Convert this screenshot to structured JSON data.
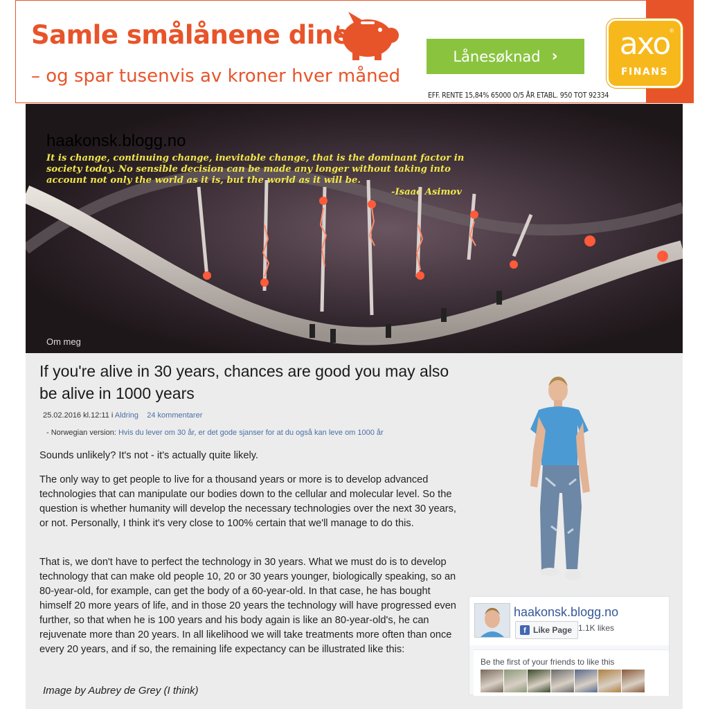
{
  "ad": {
    "headline": "Samle smålånene dine",
    "subline": "– og spar tusenvis av kroner hver måned",
    "cta_label": "Lånesøknad",
    "cta_arrow": "›",
    "fine_print": "EFF. RENTE 15,84% 65000 O/5 ÅR ETABL. 950 TOT 92334",
    "brand": "axo",
    "brand_sub": "FINANS",
    "brand_reg": "®",
    "colors": {
      "orange": "#e8542a",
      "green": "#8ac43f",
      "yellow": "#f7b81b"
    }
  },
  "header": {
    "blog_title": "haakonsk.blogg.no",
    "quote": "It is change, continuing change, inevitable change, that is the dominant factor in society today. No sensible decision can be made any longer without taking into account not only the world as it is, but the world as it will be.",
    "quote_author": "-Isaac Asimov",
    "nav_link": "Om meg"
  },
  "post": {
    "title": "If you're alive in 30 years, chances are good you may also be alive in 1000 years",
    "date": "25.02.2016 kl.12:11",
    "category_prefix": " i ",
    "category": "Aldring",
    "comments": "24 kommentarer",
    "norwegian_prefix": "- Norwegian version: ",
    "norwegian_link": "Hvis du lever om 30 år, er det gode sjanser for at du også kan leve om 1000 år",
    "paragraphs": [
      "Sounds unlikely? It's not - it's actually quite likely.",
      "The only way to get people to live for a thousand years or more is to develop advanced technologies that can manipulate our bodies down to the cellular and molecular level. So the question is whether humanity will develop the necessary technologies over the next 30 years, or not. Personally, I think it's very close to 100% certain that we'll manage to do this.",
      "That is, we don't have to perfect the technology in 30 years. What we must do is to develop technology that can make old people 10, 20 or 30 years younger, biologically speaking, so an 80-year-old, for example, can get the body of a 60-year-old. In that case, he has bought himself 20 more years of life, and in those 20 years the technology will have progressed even further, so that when he is 100 years and his body again is like an 80-year-old's, he can rejuvenate more than 20 years. In all likelihood we will take treatments more often than once every 20 years, and if so, the remaining life expectancy can be illustrated like this:"
    ],
    "image_caption": "Image by Aubrey de Grey (I think)"
  },
  "fb_widget": {
    "page_name": "haakonsk.blogg.no",
    "like_label": "Like Page",
    "like_icon": "f",
    "likes": "1.1K likes",
    "friends_text": "Be the first of your friends to like this",
    "faces": [
      "#7a6a5c",
      "#8a9a7a",
      "#3a4a2a",
      "#6a6a6a",
      "#5a6a8a",
      "#b08040",
      "#8a5a3a"
    ]
  }
}
